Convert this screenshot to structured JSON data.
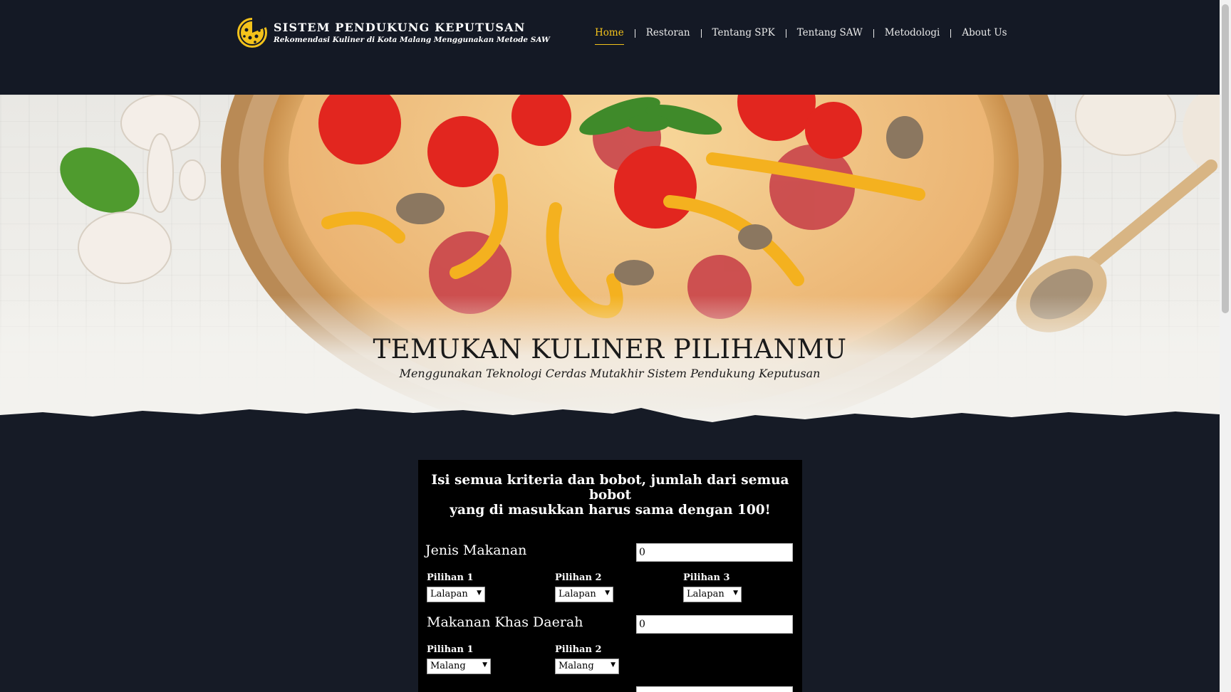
{
  "header": {
    "title": "SISTEM PENDUKUNG KEPUTUSAN",
    "subtitle": "Rekomendasi Kuliner di Kota Malang Menggunakan Metode SAW",
    "nav": [
      {
        "label": "Home",
        "active": true
      },
      {
        "label": "Restoran",
        "active": false
      },
      {
        "label": "Tentang SPK",
        "active": false
      },
      {
        "label": "Tentang SAW",
        "active": false
      },
      {
        "label": "Metodologi",
        "active": false
      },
      {
        "label": "About Us",
        "active": false
      }
    ]
  },
  "hero": {
    "title": "TEMUKAN KULINER PILIHANMU",
    "subtitle": "Menggunakan Teknologi Cerdas Mutakhir Sistem Pendukung Keputusan"
  },
  "form": {
    "heading_line1": "Isi semua kriteria dan bobot, jumlah dari semua bobot",
    "heading_line2": "yang di masukkan harus sama dengan 100!",
    "criteria": [
      {
        "label": "Jenis Makanan",
        "weight": "0",
        "options": [
          {
            "label": "Pilihan 1",
            "value": "Lalapan"
          },
          {
            "label": "Pilihan 2",
            "value": "Lalapan"
          },
          {
            "label": "Pilihan 3",
            "value": "Lalapan"
          }
        ]
      },
      {
        "label": "Makanan Khas Daerah",
        "weight": "0",
        "options": [
          {
            "label": "Pilihan 1",
            "value": "Malang"
          },
          {
            "label": "Pilihan 2",
            "value": "Malang"
          }
        ]
      }
    ]
  },
  "colors": {
    "accent": "#f3c21b",
    "header_bg": "#141925",
    "page_bg": "#161b26",
    "panel_bg": "#000000"
  },
  "icons": {
    "logo": "pizza-logo-icon",
    "dropdown": "triangle-down-icon"
  }
}
